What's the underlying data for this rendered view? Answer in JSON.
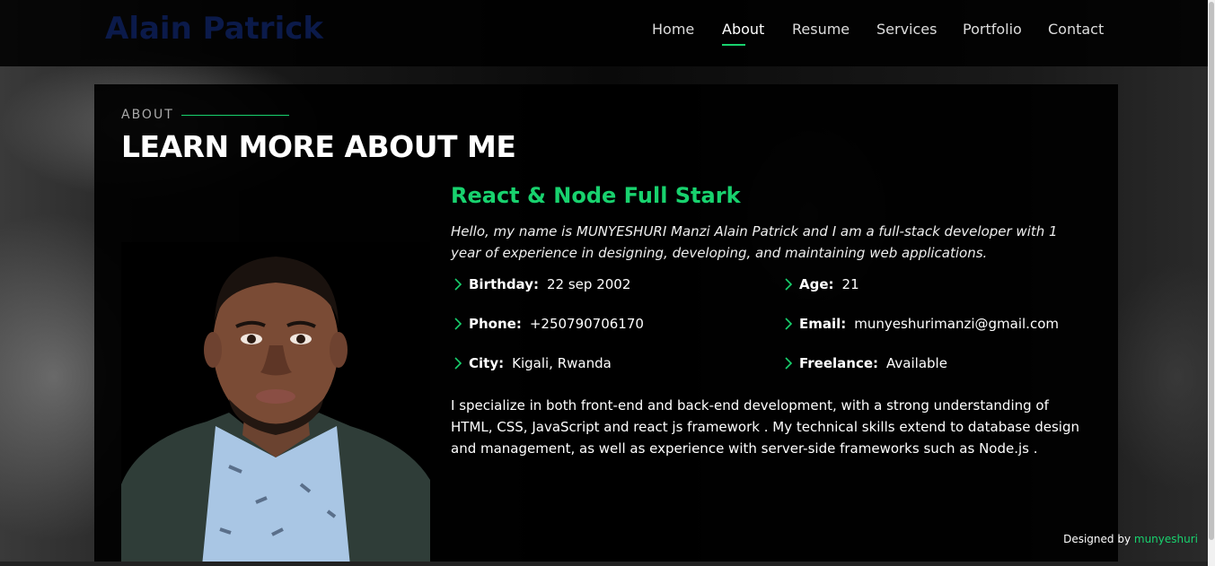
{
  "header": {
    "logo": "Alain Patrick",
    "nav": [
      {
        "label": "Home",
        "active": false
      },
      {
        "label": "About",
        "active": true
      },
      {
        "label": "Resume",
        "active": false
      },
      {
        "label": "Services",
        "active": false
      },
      {
        "label": "Portfolio",
        "active": false
      },
      {
        "label": "Contact",
        "active": false
      }
    ]
  },
  "about": {
    "section_label": "ABOUT",
    "title": "LEARN MORE ABOUT ME",
    "role": "React & Node Full Stark",
    "intro": "Hello, my name is MUNYESHURI Manzi Alain Patrick and I am a full-stack developer with 1 year of experience in designing, developing, and maintaining web applications.",
    "facts": {
      "birthday": {
        "label": "Birthday:",
        "value": "22 sep 2002"
      },
      "age": {
        "label": "Age:",
        "value": "21"
      },
      "phone": {
        "label": "Phone:",
        "value": "+250790706170"
      },
      "email": {
        "label": "Email:",
        "value": "munyeshurimanzi@gmail.com"
      },
      "city": {
        "label": "City:",
        "value": "Kigali, Rwanda"
      },
      "freelance": {
        "label": "Freelance:",
        "value": "Available"
      }
    },
    "description": "I specialize in both front-end and back-end development, with a strong understanding of HTML, CSS, JavaScript and react js framework . My technical skills extend to database design and management, as well as experience with server-side frameworks such as Node.js ."
  },
  "footer": {
    "designed_by": "Designed by",
    "author": "munyeshuri"
  },
  "colors": {
    "accent": "#18d26e",
    "logo": "#0b1a4a",
    "background": "#000000"
  },
  "icons": {
    "fact_bullet": "chevron-right-icon"
  }
}
